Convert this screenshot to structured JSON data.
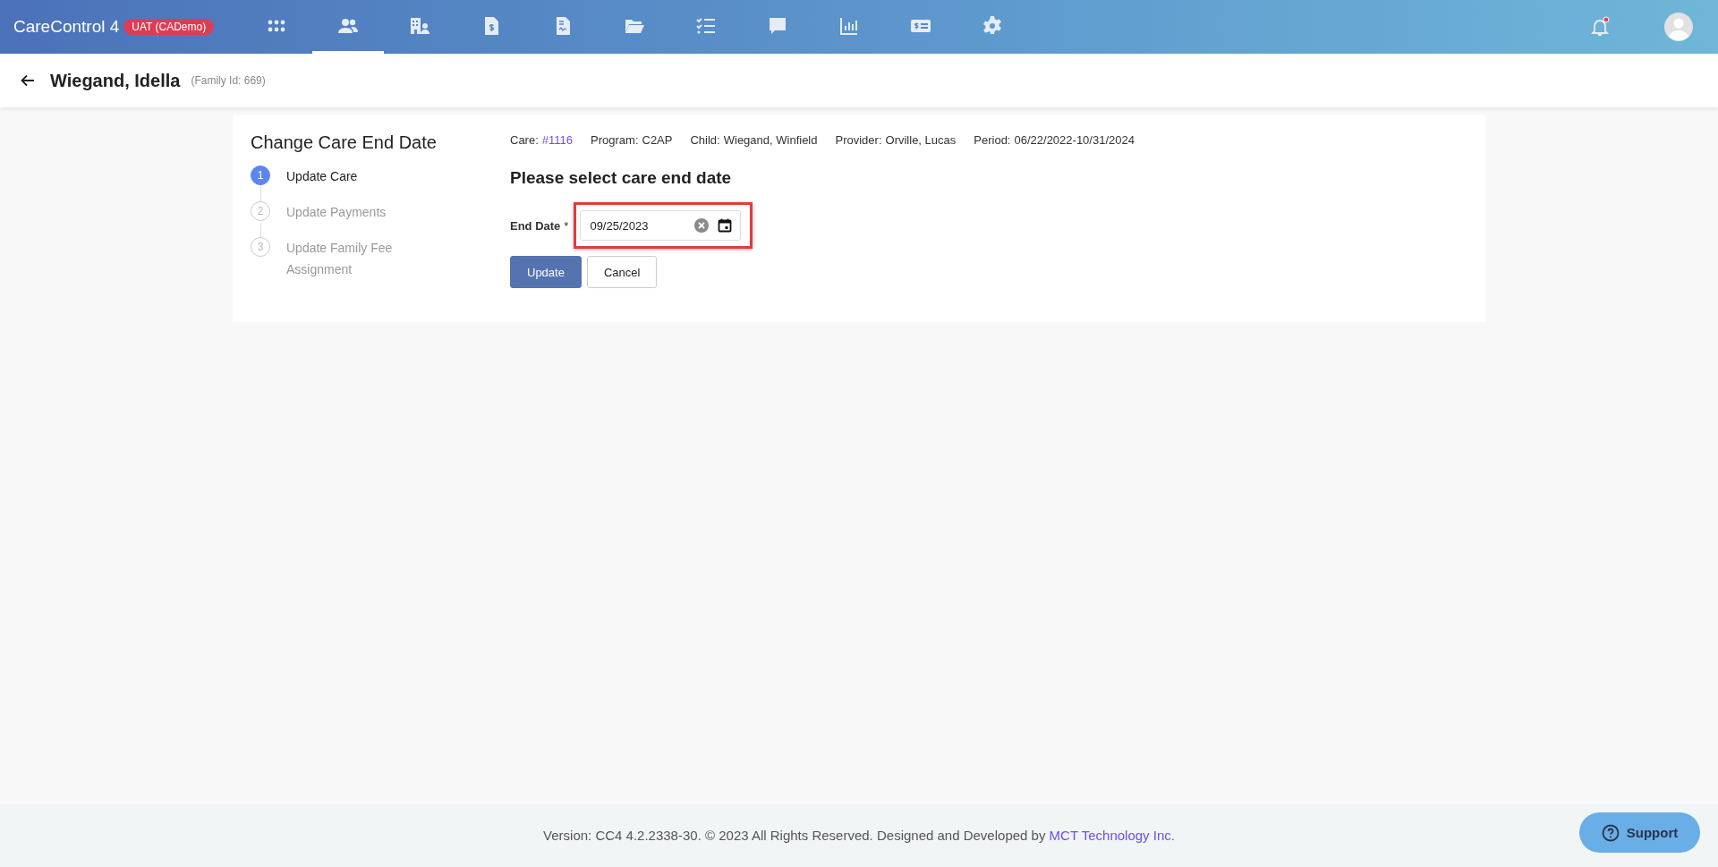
{
  "app": {
    "title": "CareControl 4",
    "env_badge": "UAT (CADemo)"
  },
  "nav_items": [
    {
      "kind": "apps",
      "selected": false
    },
    {
      "kind": "people",
      "selected": true
    },
    {
      "kind": "building",
      "selected": false
    },
    {
      "kind": "invoice",
      "selected": false
    },
    {
      "kind": "contract",
      "selected": false
    },
    {
      "kind": "folder",
      "selected": false
    },
    {
      "kind": "checklist",
      "selected": false
    },
    {
      "kind": "chat",
      "selected": false
    },
    {
      "kind": "chart",
      "selected": false
    },
    {
      "kind": "money",
      "selected": false
    },
    {
      "kind": "gear",
      "selected": false
    }
  ],
  "page_header": {
    "title": "Wiegand, Idella",
    "subtitle": "(Family Id: 669)"
  },
  "wizard": {
    "title": "Change Care End Date",
    "steps": [
      {
        "number": "1",
        "label": "Update Care",
        "selected": true
      },
      {
        "number": "2",
        "label": "Update Payments",
        "selected": false
      },
      {
        "number": "3",
        "label": "Update Family Fee Assignment",
        "selected": false
      }
    ]
  },
  "care_info": [
    {
      "label": "Care:",
      "value": "#1116",
      "kind": "link"
    },
    {
      "label": "Program:",
      "value": "C2AP",
      "kind": "text"
    },
    {
      "label": "Child:",
      "value": "Wiegand, Winfield",
      "kind": "text"
    },
    {
      "label": "Provider:",
      "value": "Orville, Lucas",
      "kind": "text"
    },
    {
      "label": "Period:",
      "value": "06/22/2022-10/31/2024",
      "kind": "text"
    }
  ],
  "form": {
    "heading": "Please select care end date",
    "field": {
      "label": "End Date",
      "required_mark": "*",
      "value": "09/25/2023",
      "highlighted": true
    },
    "buttons": [
      {
        "label": "Update",
        "kind": "primary"
      },
      {
        "label": "Cancel",
        "kind": "secondary"
      }
    ]
  },
  "footer": {
    "text": "Version: CC4 4.2.2338-30. © 2023 All Rights Reserved. Designed and Developed by ",
    "link": "MCT Technology Inc."
  },
  "support_button": {
    "label": "Support"
  }
}
